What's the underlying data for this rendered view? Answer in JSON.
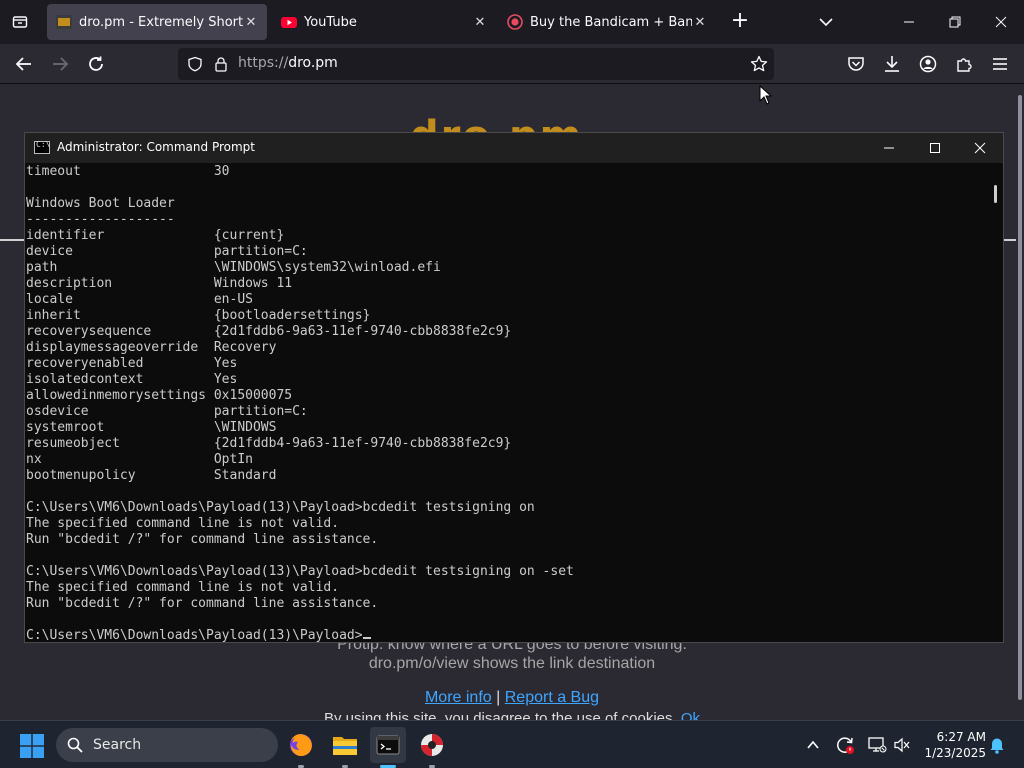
{
  "browser": {
    "tabs": [
      {
        "title": "dro.pm - Extremely Short Links",
        "active": true
      },
      {
        "title": "YouTube",
        "active": false
      },
      {
        "title": "Buy the Bandicam + Bandicut p",
        "active": false
      }
    ],
    "url_scheme": "https://",
    "url_host": "dro.pm",
    "accent": "#c28d1c"
  },
  "page": {
    "logo": "dro.pm",
    "protip": "Protip: know where a URL goes to before visiting.",
    "view_hint": "dro.pm/o/view shows the link destination",
    "more_info": "More info",
    "separator": "|",
    "report_bug": "Report a Bug",
    "cookie_text": "By using this site, you disagree to the use of cookies.",
    "cookie_ok": "Ok"
  },
  "cmd": {
    "title": "Administrator: Command Prompt",
    "icon_text": "C:\\",
    "lines": [
      "timeout                 30",
      "",
      "Windows Boot Loader",
      "-------------------",
      "identifier              {current}",
      "device                  partition=C:",
      "path                    \\WINDOWS\\system32\\winload.efi",
      "description             Windows 11",
      "locale                  en-US",
      "inherit                 {bootloadersettings}",
      "recoverysequence        {2d1fddb6-9a63-11ef-9740-cbb8838fe2c9}",
      "displaymessageoverride  Recovery",
      "recoveryenabled         Yes",
      "isolatedcontext         Yes",
      "allowedinmemorysettings 0x15000075",
      "osdevice                partition=C:",
      "systemroot              \\WINDOWS",
      "resumeobject            {2d1fddb4-9a63-11ef-9740-cbb8838fe2c9}",
      "nx                      OptIn",
      "bootmenupolicy          Standard",
      "",
      "C:\\Users\\VM6\\Downloads\\Payload(13)\\Payload>bcdedit testsigning on",
      "The specified command line is not valid.",
      "Run \"bcdedit /?\" for command line assistance.",
      "",
      "C:\\Users\\VM6\\Downloads\\Payload(13)\\Payload>bcdedit testsigning on -set",
      "The specified command line is not valid.",
      "Run \"bcdedit /?\" for command line assistance.",
      ""
    ],
    "prompt": "C:\\Users\\VM6\\Downloads\\Payload(13)\\Payload>"
  },
  "taskbar": {
    "search_label": "Search",
    "time": "6:27 AM",
    "date": "1/23/2025"
  }
}
